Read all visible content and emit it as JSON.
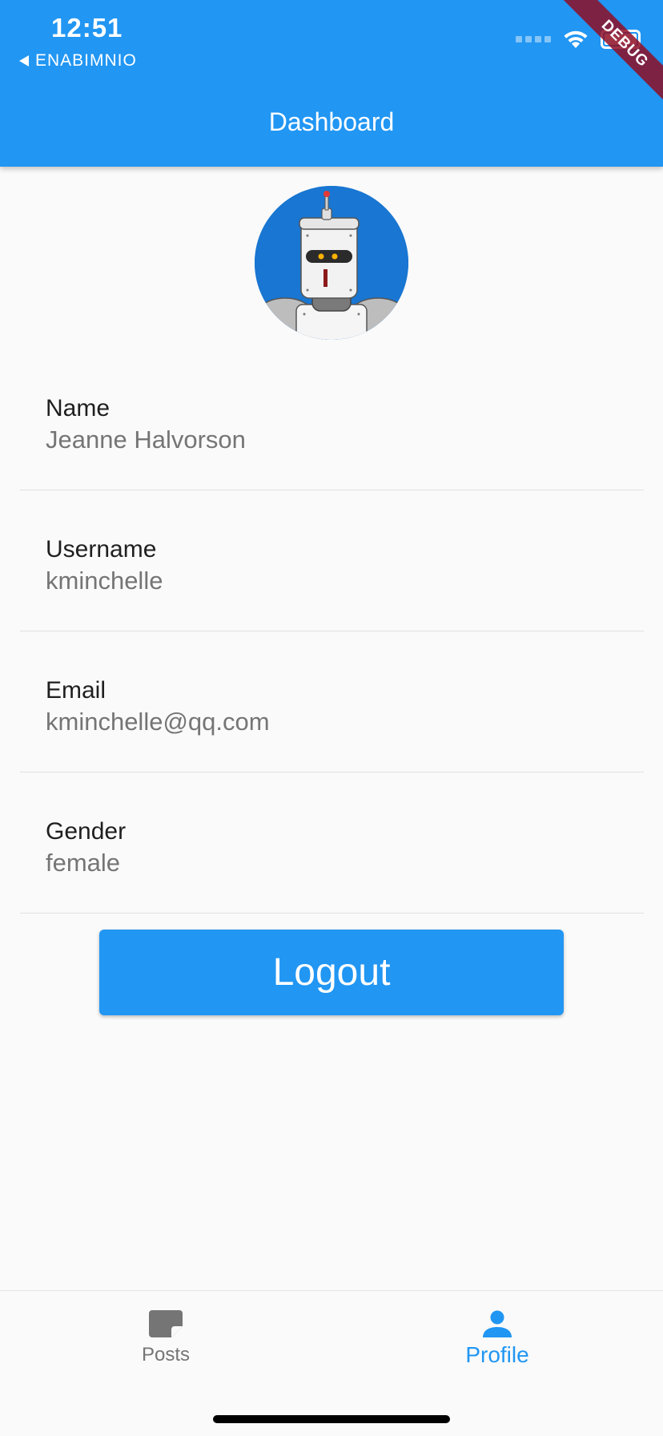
{
  "status_bar": {
    "time": "12:51",
    "back_app": "ENABIMNIO"
  },
  "debug_banner": "DEBUG",
  "app_bar": {
    "title": "Dashboard"
  },
  "profile": {
    "avatar_icon": "robot-avatar-icon",
    "fields": [
      {
        "label": "Name",
        "value": "Jeanne Halvorson"
      },
      {
        "label": "Username",
        "value": "kminchelle"
      },
      {
        "label": "Email",
        "value": "kminchelle@qq.com"
      },
      {
        "label": "Gender",
        "value": "female"
      }
    ]
  },
  "logout_label": "Logout",
  "bottom_nav": {
    "items": [
      {
        "label": "Posts",
        "icon": "document-icon",
        "active": false
      },
      {
        "label": "Profile",
        "icon": "person-icon",
        "active": true
      }
    ]
  },
  "colors": {
    "primary": "#2196f3",
    "inactive": "#757575",
    "debug": "#8e0e24"
  }
}
